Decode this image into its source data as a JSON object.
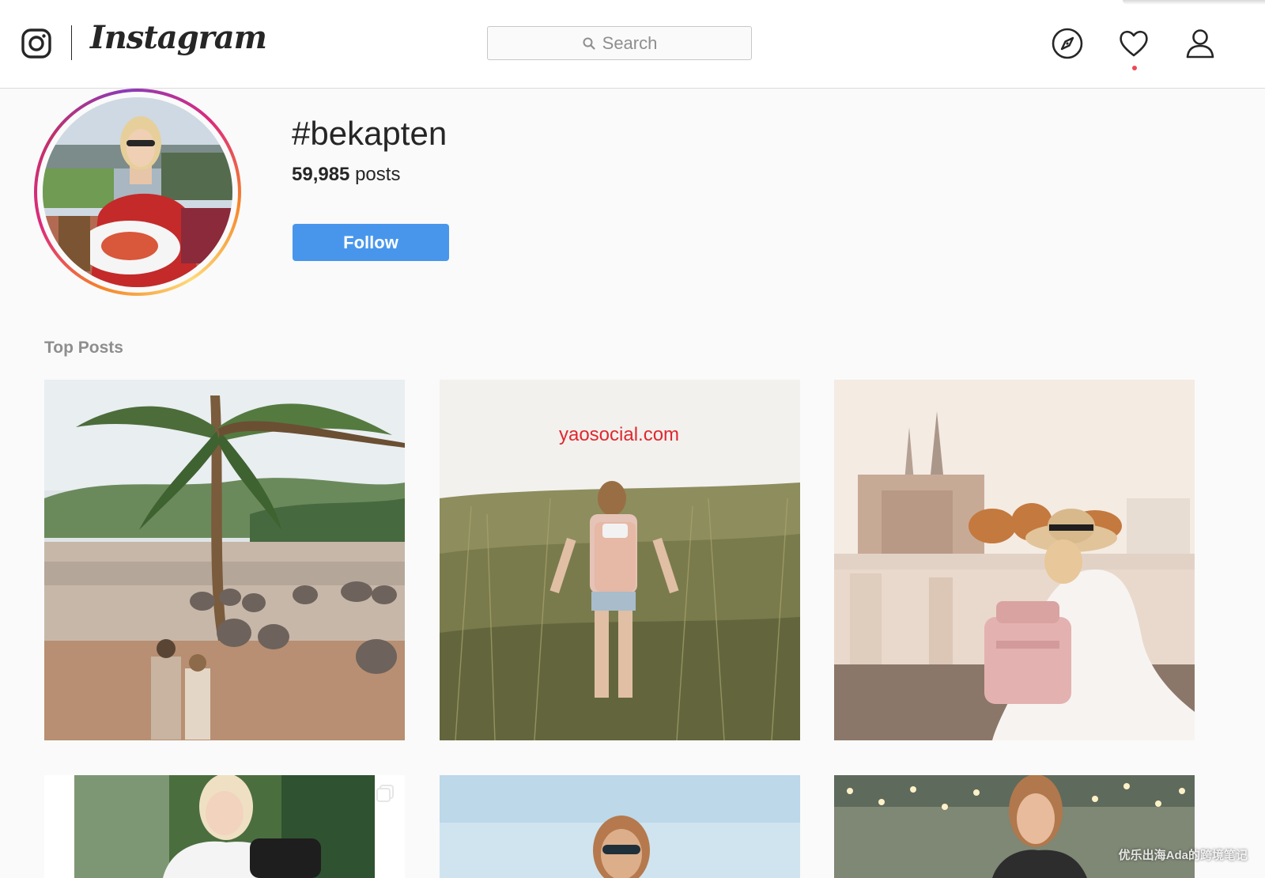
{
  "nav": {
    "brand_wordmark": "Instagram",
    "search": {
      "placeholder": "Search",
      "icon": "search-icon"
    },
    "icons": [
      "explore-compass-icon",
      "activity-heart-icon",
      "profile-icon"
    ],
    "has_notification_dot": true
  },
  "header": {
    "hashtag": "#bekapten",
    "post_count": "59,985",
    "post_count_suffix": "posts",
    "follow_label": "Follow"
  },
  "top_posts": {
    "label": "Top Posts"
  },
  "overlay": {
    "watermark_url": "yaosocial.com",
    "footer_watermark": "优乐出海Ada的跨境笔记"
  },
  "colors": {
    "accent_blue": "#4896ec",
    "notification_red": "#ed4956",
    "watermark_red": "#e0282e",
    "text_dark": "#262626",
    "text_muted": "#8e8e8e"
  }
}
